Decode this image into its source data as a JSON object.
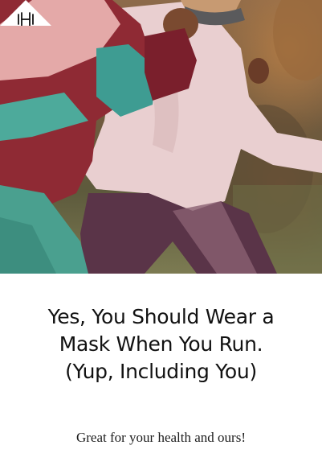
{
  "hero": {
    "image_description": "",
    "logo_icon": "dumbbell-icon"
  },
  "article": {
    "title": "Yes, You Should Wear a Mask When You Run. (Yup, Including You)",
    "subtitle": "Great for your health and ours!"
  },
  "colors": {
    "background": "#ffffff",
    "title_text": "#111111",
    "badge": "#ffffff"
  }
}
